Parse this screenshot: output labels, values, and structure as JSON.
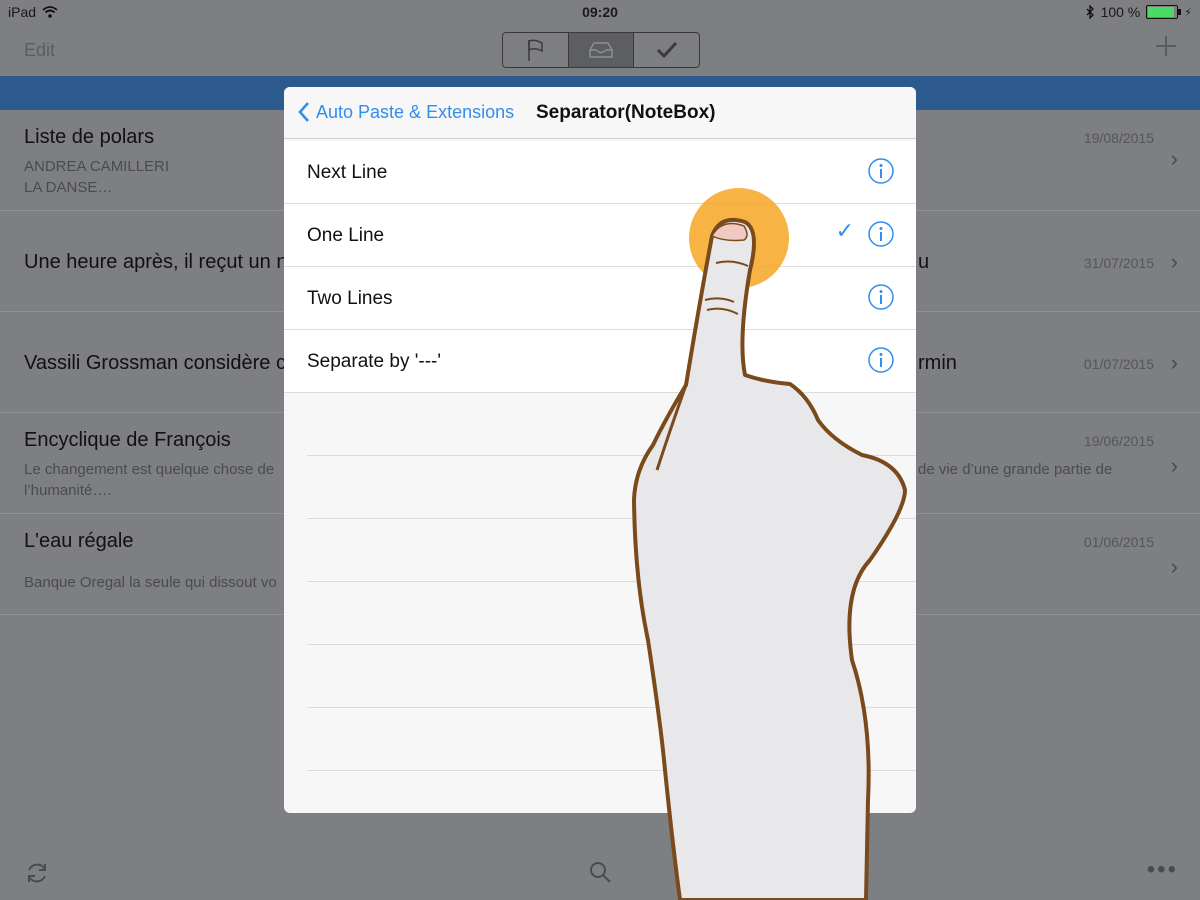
{
  "status": {
    "device": "iPad",
    "time": "09:20",
    "battery": "100 %"
  },
  "nav": {
    "edit_label": "Edit",
    "segments": [
      {
        "icon": "flag-icon",
        "active": false
      },
      {
        "icon": "inbox-icon",
        "active": true
      },
      {
        "icon": "checkmark-icon",
        "active": false
      }
    ]
  },
  "notes": [
    {
      "title": "Liste de polars",
      "title_right": "",
      "preview_lines": [
        "ANDREA CAMILLERI",
        "LA DANSE…"
      ],
      "preview_right": "",
      "date": "19/08/2015"
    },
    {
      "title": "Une heure après, il reçut un n",
      "title_right": "u",
      "preview_lines": [],
      "preview_right": "",
      "date": "31/07/2015"
    },
    {
      "title": "Vassili Grossman considère c",
      "title_right": "rmin",
      "preview_lines": [],
      "preview_right": "",
      "date": "01/07/2015"
    },
    {
      "title": "Encyclique de François",
      "title_right": "",
      "preview_lines": [
        "Le changement est quelque chose de",
        "l’humanité…."
      ],
      "preview_right": "de vie d’une grande partie de",
      "date": "19/06/2015"
    },
    {
      "title": "L'eau régale",
      "title_right": "",
      "preview_lines": [
        "Banque Oregal la seule qui dissout vo"
      ],
      "preview_right": "",
      "date": "01/06/2015"
    }
  ],
  "popover": {
    "back_label": "Auto Paste & Extensions",
    "title": "Separator(NoteBox)",
    "options": [
      {
        "label": "Next Line",
        "selected": false
      },
      {
        "label": "One Line",
        "selected": true
      },
      {
        "label": "Two Lines",
        "selected": false
      },
      {
        "label": "Separate by '---'",
        "selected": false
      }
    ]
  },
  "colors": {
    "accent": "#2f8ef1",
    "banner": "#2c5a8e",
    "touch": "#f6a623"
  }
}
